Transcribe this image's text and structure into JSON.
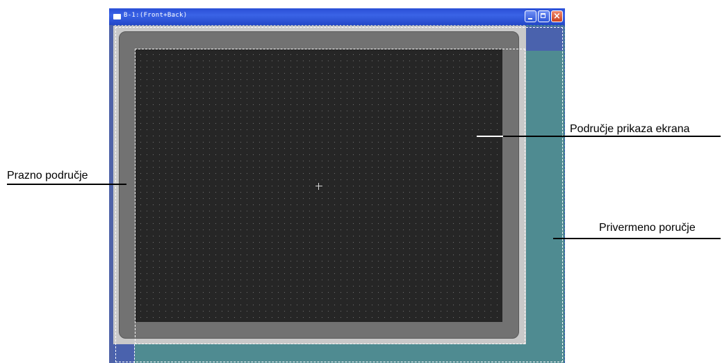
{
  "window": {
    "title": "B-1:(Front+Back)",
    "buttons": {
      "minimize": "minimize-icon",
      "maximize": "maximize-icon",
      "close": "close-icon"
    }
  },
  "callouts": {
    "blank_area": "Prazno područje",
    "screen_area": "Područje prikaza ekrana",
    "temporary_area": "Privermeno poručje"
  },
  "colors": {
    "title_bar": "#2a4fd6",
    "screen": "#262626",
    "bezel": "#727272",
    "temporary_area": "#4f8b91",
    "blank_area": "#c9c9c9"
  }
}
